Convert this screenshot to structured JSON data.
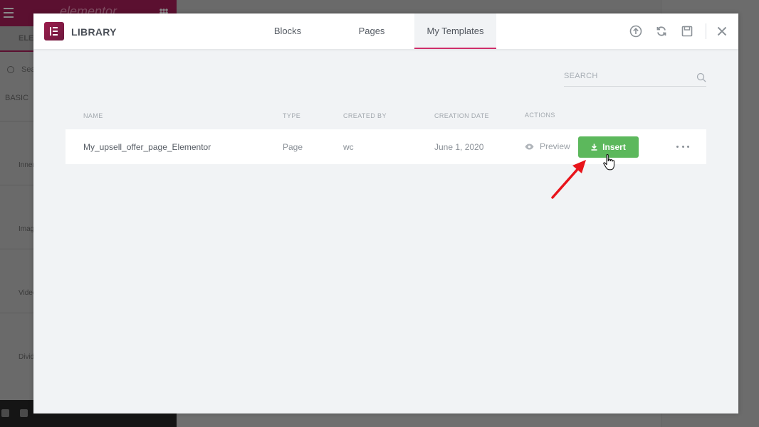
{
  "background": {
    "brand": "elementor",
    "tab_label": "ELEMENTS",
    "search_placeholder": "Search Widget...",
    "category": "BASIC",
    "widgets": [
      "Inner Section",
      "Image",
      "Video",
      "Divider"
    ]
  },
  "library": {
    "title": "LIBRARY",
    "tabs": [
      "Blocks",
      "Pages",
      "My Templates"
    ],
    "active_tab": "My Templates",
    "header_icons": [
      "upload-icon",
      "sync-icon",
      "save-icon",
      "close-icon"
    ],
    "search_placeholder": "SEARCH",
    "columns": [
      "NAME",
      "TYPE",
      "CREATED BY",
      "CREATION DATE",
      "ACTIONS"
    ],
    "templates": [
      {
        "name": "My_upsell_offer_page_Elementor",
        "type": "Page",
        "created_by": "wc",
        "creation_date": "June 1, 2020",
        "preview_label": "Preview",
        "insert_label": "Insert"
      }
    ]
  },
  "colors": {
    "accent": "#cf2e6a",
    "insert_green": "#5cb85c",
    "annotation_arrow": "#e8141b"
  }
}
